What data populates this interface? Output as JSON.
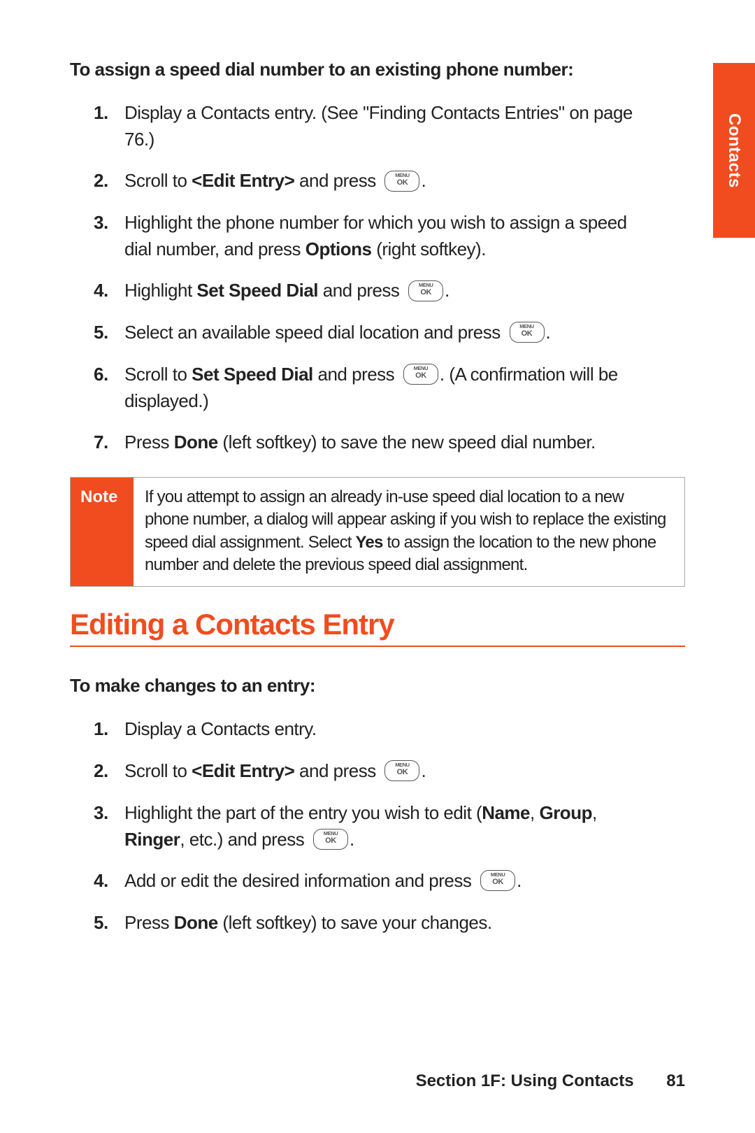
{
  "sideTab": "Contacts",
  "section1": {
    "subhead": "To assign a speed dial number to an existing phone number:"
  },
  "steps1": {
    "s1": "Display a Contacts entry. (See \"Finding Contacts Entries\" on page 76.)",
    "s2_a": "Scroll to ",
    "s2_b": "<Edit Entry>",
    "s2_c": " and press ",
    "s2_d": ".",
    "s3_a": "Highlight the phone number for which you wish to assign a speed dial number, and press ",
    "s3_b": "Options",
    "s3_c": " (right softkey).",
    "s4_a": "Highlight ",
    "s4_b": "Set Speed Dial",
    "s4_c": " and press ",
    "s4_d": ".",
    "s5_a": "Select an available speed dial location and press ",
    "s5_b": ".",
    "s6_a": "Scroll to ",
    "s6_b": "Set Speed Dial",
    "s6_c": " and press ",
    "s6_d": ". (A confirmation will be displayed.)",
    "s7_a": "Press ",
    "s7_b": "Done",
    "s7_c": " (left softkey) to save the new speed dial number."
  },
  "note": {
    "label": "Note",
    "body_a": "If you attempt to assign an already in-use speed dial location to a new phone number, a dialog will appear asking if you wish to replace the existing speed dial assignment. Select ",
    "body_b": "Yes",
    "body_c": " to assign the location to the new phone number and delete the previous speed dial assignment."
  },
  "section2": {
    "title": "Editing a Contacts Entry",
    "subhead": "To make changes to an entry:"
  },
  "steps2": {
    "s1": "Display a Contacts entry.",
    "s2_a": "Scroll to ",
    "s2_b": "<Edit Entry>",
    "s2_c": " and press ",
    "s2_d": ".",
    "s3_a": "Highlight the part of the entry you wish to edit (",
    "s3_b": "Name",
    "s3_c": ", ",
    "s3_d": "Group",
    "s3_e": ", ",
    "s3_f": "Ringer",
    "s3_g": ", etc.) and press ",
    "s3_h": ".",
    "s4_a": "Add or edit the desired information and press ",
    "s4_b": ".",
    "s5_a": "Press ",
    "s5_b": "Done",
    "s5_c": " (left softkey) to save your changes."
  },
  "footer": {
    "section": "Section 1F: Using Contacts",
    "page": "81"
  }
}
